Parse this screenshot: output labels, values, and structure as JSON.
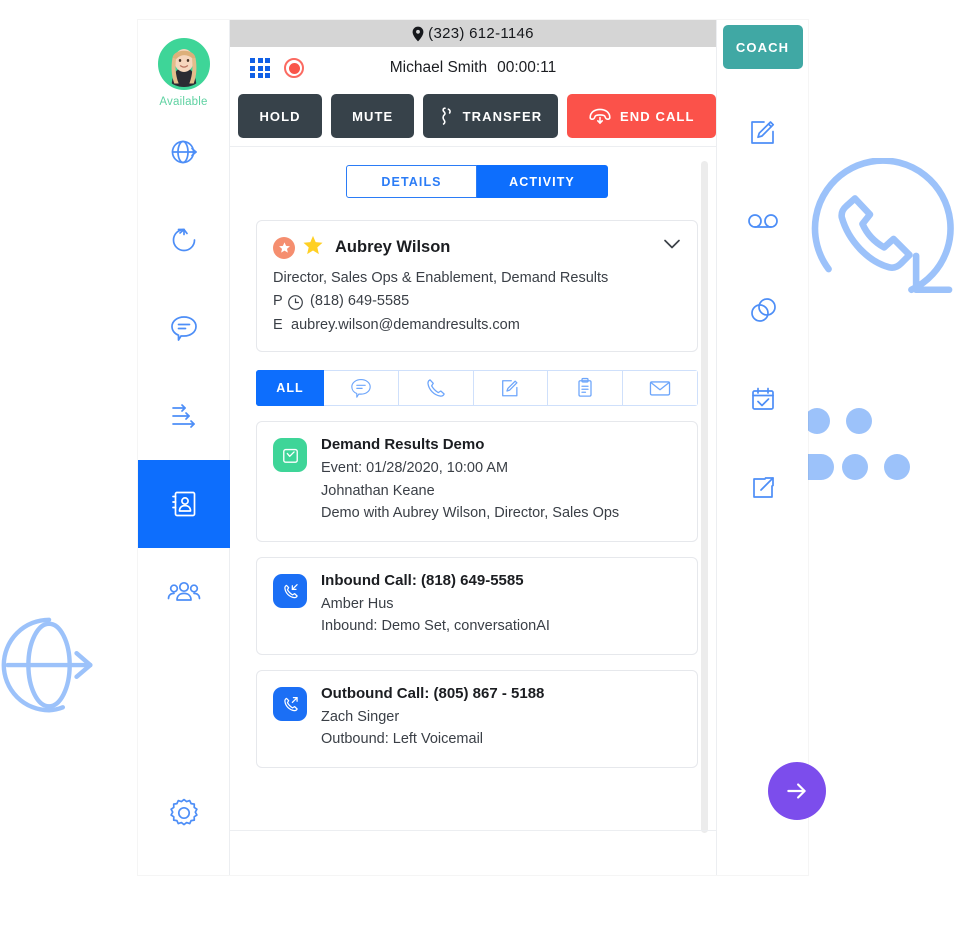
{
  "user": {
    "status_label": "Available",
    "avatar_name": "agent-avatar"
  },
  "left_rail": {
    "items": [
      {
        "name": "globe-arrow-icon",
        "label": "Web Lead",
        "active": false
      },
      {
        "name": "refresh-clockwise-icon",
        "label": "Refresh",
        "active": false
      },
      {
        "name": "chat-bubble-icon",
        "label": "Messages",
        "active": false
      },
      {
        "name": "arrows-flow-icon",
        "label": "Workflows",
        "active": false
      },
      {
        "name": "contact-book-icon",
        "label": "Contacts",
        "active": true
      },
      {
        "name": "people-group-icon",
        "label": "Teams",
        "active": false
      },
      {
        "name": "gear-icon",
        "label": "Settings",
        "active": false
      }
    ]
  },
  "location_bar": {
    "phone_number": "(323) 612-1146",
    "pin_icon": "map-pin-icon"
  },
  "call_bar": {
    "dialpad_icon": "dialpad-icon",
    "record_icon": "record-icon",
    "party_name": "Michael Smith",
    "timer": "00:00:11"
  },
  "controls": {
    "hold_label": "HOLD",
    "mute_label": "MUTE",
    "transfer_label": "TRANSFER",
    "end_call_label": "END CALL",
    "coach_label": "COACH",
    "colors": {
      "dark": "#37424a",
      "end_call": "#fb524a",
      "coach": "#40a8a4",
      "accent_blue": "#0d6efd"
    }
  },
  "tabs": [
    {
      "label": "DETAILS",
      "active": false
    },
    {
      "label": "ACTIVITY",
      "active": true
    }
  ],
  "contact": {
    "name": "Aubrey Wilson",
    "badge_icon": "star-badge-icon",
    "favorite_icon": "gold-star-icon",
    "chevron_icon": "chevron-down-icon",
    "title": "Director, Sales Ops & Enablement, Demand Results",
    "phone_tag": "P",
    "phone_icon": "clock-icon",
    "phone": "(818) 649-5585",
    "email_tag": "E",
    "email": "aubrey.wilson@demandresults.com"
  },
  "filters": [
    {
      "label": "ALL",
      "icon": "",
      "active": true
    },
    {
      "label": "",
      "icon": "chat-bubble-icon",
      "active": false
    },
    {
      "label": "",
      "icon": "phone-icon",
      "active": false
    },
    {
      "label": "",
      "icon": "note-edit-icon",
      "active": false
    },
    {
      "label": "",
      "icon": "clipboard-icon",
      "active": false
    },
    {
      "label": "",
      "icon": "envelope-icon",
      "active": false
    }
  ],
  "activities": [
    {
      "icon": "calendar-check-icon",
      "icon_color": "#3ed598",
      "title": "Demand Results Demo",
      "line1": "Event: 01/28/2020, 10:00 AM",
      "line2": "Johnathan Keane",
      "line3": "Demo with Aubrey Wilson, Director, Sales Ops"
    },
    {
      "icon": "phone-incoming-icon",
      "icon_color": "#1b6ff5",
      "title": "Inbound Call: (818) 649-5585",
      "line1": "Amber Hus",
      "line2": "Inbound: Demo Set, conversationAI",
      "line3": ""
    },
    {
      "icon": "phone-outgoing-icon",
      "icon_color": "#1b6ff5",
      "title": "Outbound Call: (805) 867 - 5188",
      "line1": "Zach Singer",
      "line2": "Outbound: Left Voicemail",
      "line3": ""
    }
  ],
  "right_rail": {
    "items": [
      {
        "name": "note-edit-icon",
        "label": "Notes"
      },
      {
        "name": "voicemail-icon",
        "label": "Voicemail"
      },
      {
        "name": "overlapping-circles-icon",
        "label": "Merge"
      },
      {
        "name": "calendar-check-icon",
        "label": "Schedule"
      },
      {
        "name": "external-link-icon",
        "label": "Open"
      }
    ]
  },
  "decorations": {
    "globe_icon": "globe-arrow-icon",
    "phone_circle_icon": "phone-in-circle-icon",
    "dots_icon": "loading-dots-icon",
    "arrow_button_icon": "arrow-right-icon",
    "accent": "#9cc2fa",
    "arrow_button_color": "#7c4dec"
  }
}
